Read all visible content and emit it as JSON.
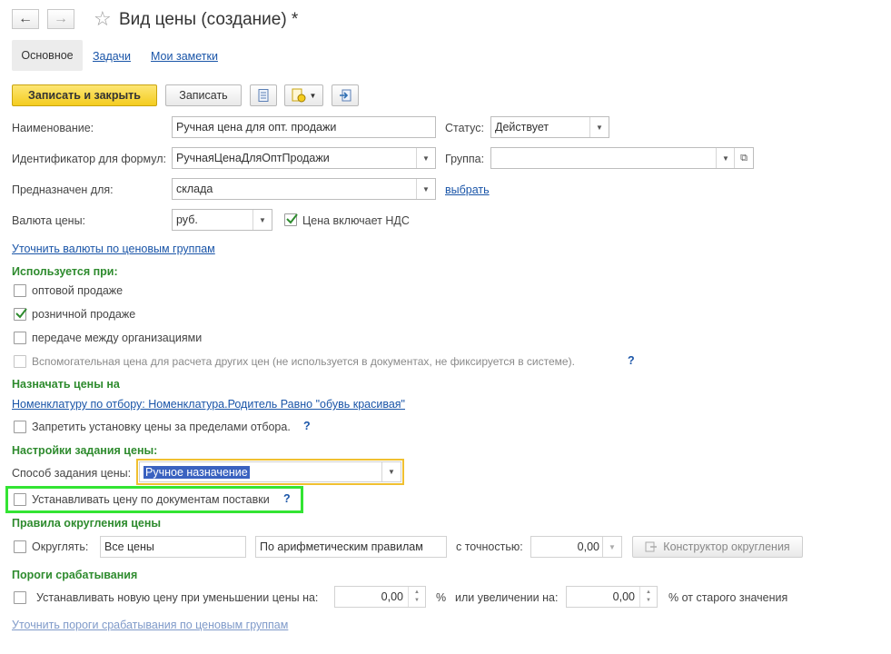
{
  "window": {
    "title": "Вид цены (создание) *"
  },
  "tabs": [
    {
      "label": "Основное"
    },
    {
      "label": "Задачи"
    },
    {
      "label": "Мои заметки"
    }
  ],
  "toolbar": {
    "save_close_label": "Записать и закрыть",
    "save_label": "Записать"
  },
  "form": {
    "name_label": "Наименование:",
    "name_value": "Ручная цена для опт. продажи",
    "status_label": "Статус:",
    "status_value": "Действует",
    "formula_id_label": "Идентификатор для формул:",
    "formula_id_value": "РучнаяЦенаДляОптПродажи",
    "group_label": "Группа:",
    "group_value": "",
    "intended_for_label": "Предназначен для:",
    "intended_for_value": "склада",
    "choose_link": "выбрать",
    "currency_label": "Валюта цены:",
    "currency_value": "руб.",
    "vat_label": "Цена включает НДС",
    "currency_groups_link": "Уточнить валюты по ценовым группам"
  },
  "used_in": {
    "heading": "Используется при:",
    "items": [
      {
        "label": "оптовой продаже",
        "checked": false
      },
      {
        "label": "розничной продаже",
        "checked": true
      },
      {
        "label": "передаче между организациями",
        "checked": false
      },
      {
        "label": "Вспомогательная цена для расчета других цен (не используется в документах, не фиксируется в системе).",
        "checked": false
      }
    ],
    "help": "?"
  },
  "assign": {
    "heading": "Назначать цены на",
    "filter_link": "Номенклатуру по отбору: Номенклатура.Родитель Равно \"обувь красивая\"",
    "forbid_label": "Запретить установку цены за пределами отбора.",
    "help": "?"
  },
  "price_settings": {
    "heading": "Настройки задания цены:",
    "method_label": "Способ задания цены:",
    "method_value": "Ручное назначение",
    "supply_docs_label": "Устанавливать цену по документам поставки",
    "help": "?"
  },
  "rounding": {
    "heading": "Правила округления цены",
    "round_label": "Округлять:",
    "scope_value": "Все цены",
    "rule_value": "По арифметическим правилам",
    "precision_label": "с точностью:",
    "precision_value": "0,00",
    "constructor_label": "Конструктор округления"
  },
  "thresholds": {
    "heading": "Пороги срабатывания",
    "set_new_label": "Устанавливать новую цену при уменьшении цены на:",
    "decrease_value": "0,00",
    "percent_sign": "%",
    "or_increase_label": "или увеличении на:",
    "increase_value": "0,00",
    "of_old_label": "% от старого значения",
    "groups_link": "Уточнить пороги срабатывания по ценовым группам"
  }
}
